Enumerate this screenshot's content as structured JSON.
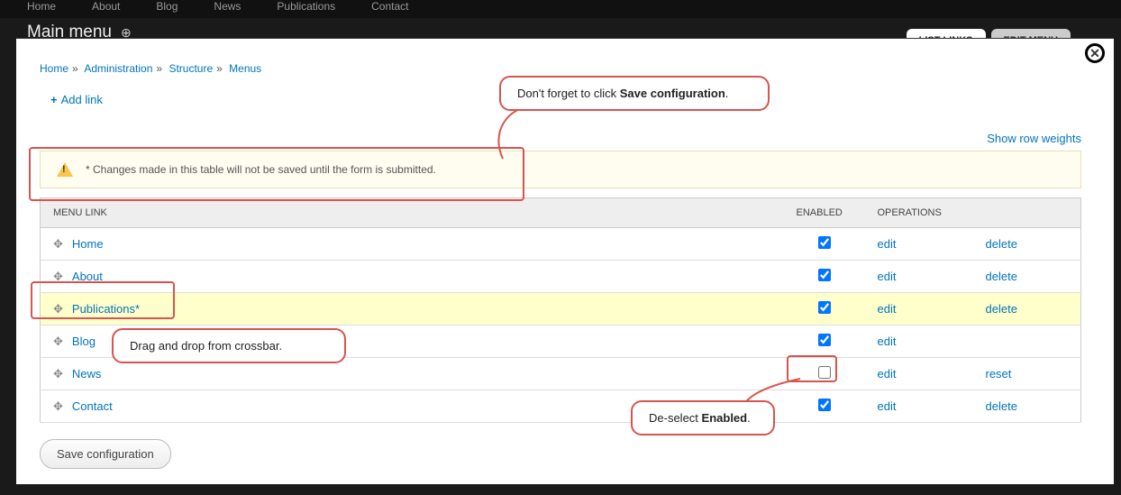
{
  "topnav": [
    "Home",
    "About",
    "Blog",
    "News",
    "Publications",
    "Contact"
  ],
  "page_title": "Main menu",
  "tabs": {
    "list": "LIST LINKS",
    "edit": "EDIT MENU"
  },
  "breadcrumb": [
    "Home",
    "Administration",
    "Structure",
    "Menus"
  ],
  "add_link": "Add link",
  "show_weights": "Show row weights",
  "warning": "* Changes made in this table will not be saved until the form is submitted.",
  "headers": {
    "menu_link": "MENU LINK",
    "enabled": "ENABLED",
    "operations": "OPERATIONS"
  },
  "rows": [
    {
      "label": "Home",
      "enabled": true,
      "highlight": false,
      "op1": "edit",
      "op2": "delete"
    },
    {
      "label": "About",
      "enabled": true,
      "highlight": false,
      "op1": "edit",
      "op2": "delete"
    },
    {
      "label": "Publications*",
      "enabled": true,
      "highlight": true,
      "op1": "edit",
      "op2": "delete"
    },
    {
      "label": "Blog",
      "enabled": true,
      "highlight": false,
      "op1": "edit",
      "op2": ""
    },
    {
      "label": "News",
      "enabled": false,
      "highlight": false,
      "op1": "edit",
      "op2": "reset"
    },
    {
      "label": "Contact",
      "enabled": true,
      "highlight": false,
      "op1": "edit",
      "op2": "delete"
    }
  ],
  "save_button": "Save configuration",
  "callouts": {
    "top_pre": "Don't forget to click ",
    "top_bold": "Save configuration",
    "top_post": ".",
    "drag": "Drag and drop from crossbar.",
    "deselect_pre": "De-select ",
    "deselect_bold": "Enabled",
    "deselect_post": "."
  }
}
